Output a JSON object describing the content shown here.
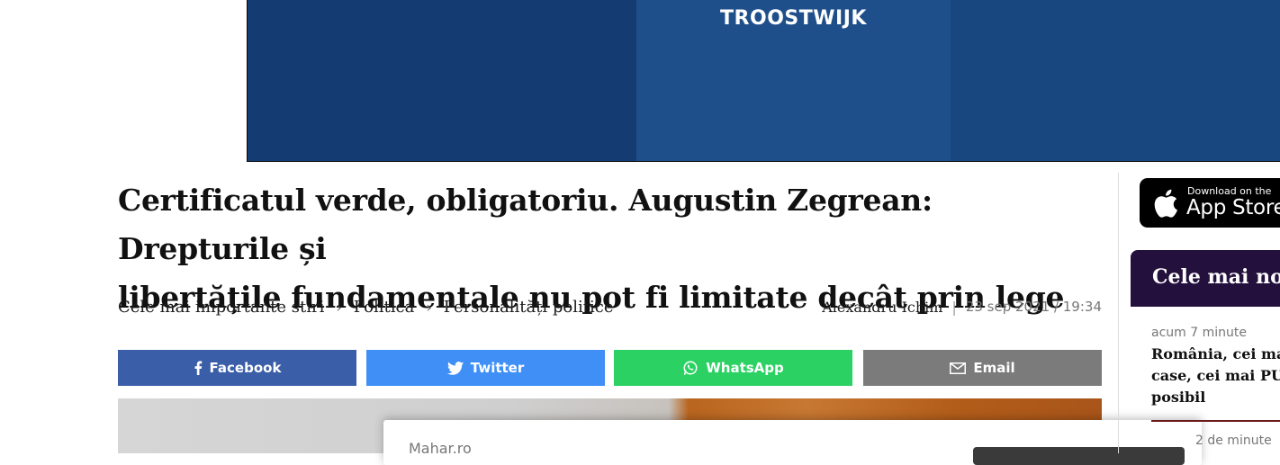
{
  "banner": {
    "brand": "TROOSTWIJK",
    "colors": {
      "background": "#143c72",
      "panel": "#1f4f8a"
    }
  },
  "article": {
    "title_line1": "Certificatul verde, obligatoriu. Augustin Zegrean: Drepturile și",
    "title_line2": "libertățile fundamentale nu pot fi limitate decât prin lege",
    "breadcrumb": [
      "Cele mai importante stiri",
      "Politica",
      "Personalități politice"
    ],
    "breadcrumb_separator": "›",
    "author": "Alexandru Ichim",
    "meta_divider": "|",
    "date": "23 sep 2021 / 19:34"
  },
  "share": {
    "facebook": {
      "label": "Facebook",
      "icon": "facebook-icon",
      "color": "#3b5ea8"
    },
    "twitter": {
      "label": "Twitter",
      "icon": "twitter-icon",
      "color": "#3f8ff7"
    },
    "whatsapp": {
      "label": "WhatsApp",
      "icon": "whatsapp-icon",
      "color": "#2bd263"
    },
    "email": {
      "label": "Email",
      "icon": "email-icon",
      "color": "#7b7b7b"
    }
  },
  "overlay": {
    "site": "Mahar.ro"
  },
  "sidebar": {
    "appstore": {
      "small": "Download on the",
      "big": "App Store",
      "icon": "apple-icon"
    },
    "latest": {
      "title": "Cele mai noi",
      "items": [
        {
          "time": "acum 7 minute",
          "headline": "România, cei mai\ncase, cei mai PUȚ\nposibil"
        }
      ],
      "next_time": "2 de minute"
    }
  }
}
